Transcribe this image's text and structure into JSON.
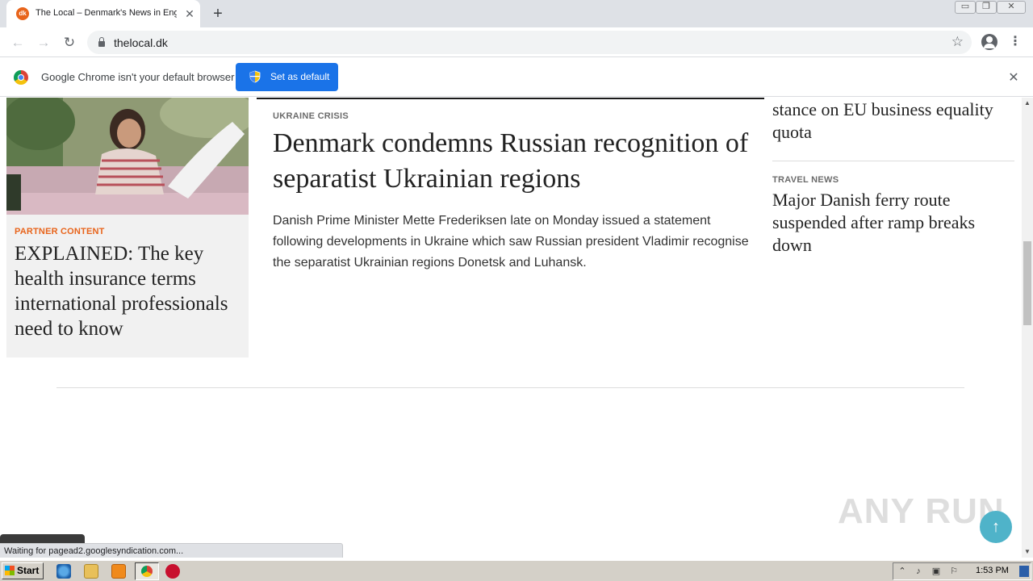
{
  "browser": {
    "tab": {
      "favicon_text": "dk",
      "title": "The Local – Denmark's News in English",
      "close_glyph": "✕"
    },
    "new_tab_glyph": "+",
    "window_controls": [
      "▭",
      "❐",
      "✕"
    ],
    "url": "thelocal.dk"
  },
  "infobar": {
    "message": "Google Chrome isn't your default browser",
    "button_label": "Set as default",
    "close_glyph": "✕"
  },
  "page": {
    "partner": {
      "tag": "PARTNER CONTENT",
      "title": "EXPLAINED: The key health insurance terms international professionals need to know"
    },
    "main": {
      "tag": "UKRAINE CRISIS",
      "title": "Denmark condemns Russian recognition of separatist Ukrainian regions",
      "excerpt": "Danish Prime Minister Mette Frederiksen late on Monday issued a statement following developments in Ukraine which saw Russian president Vladimir recognise the separatist Ukrainian regions Donetsk and Luhansk."
    },
    "side": {
      "first_title": "stance on EU business equality quota",
      "tag": "TRAVEL NEWS",
      "second_title": "Major Danish ferry route suspended after ramp breaks down"
    },
    "back_to_top_glyph": "↑",
    "watermark": "ANY RUN"
  },
  "status_bar": {
    "text": "Waiting for pagead2.googlesyndication.com..."
  },
  "taskbar": {
    "start_label": "Start",
    "clock": "1:53 PM"
  }
}
